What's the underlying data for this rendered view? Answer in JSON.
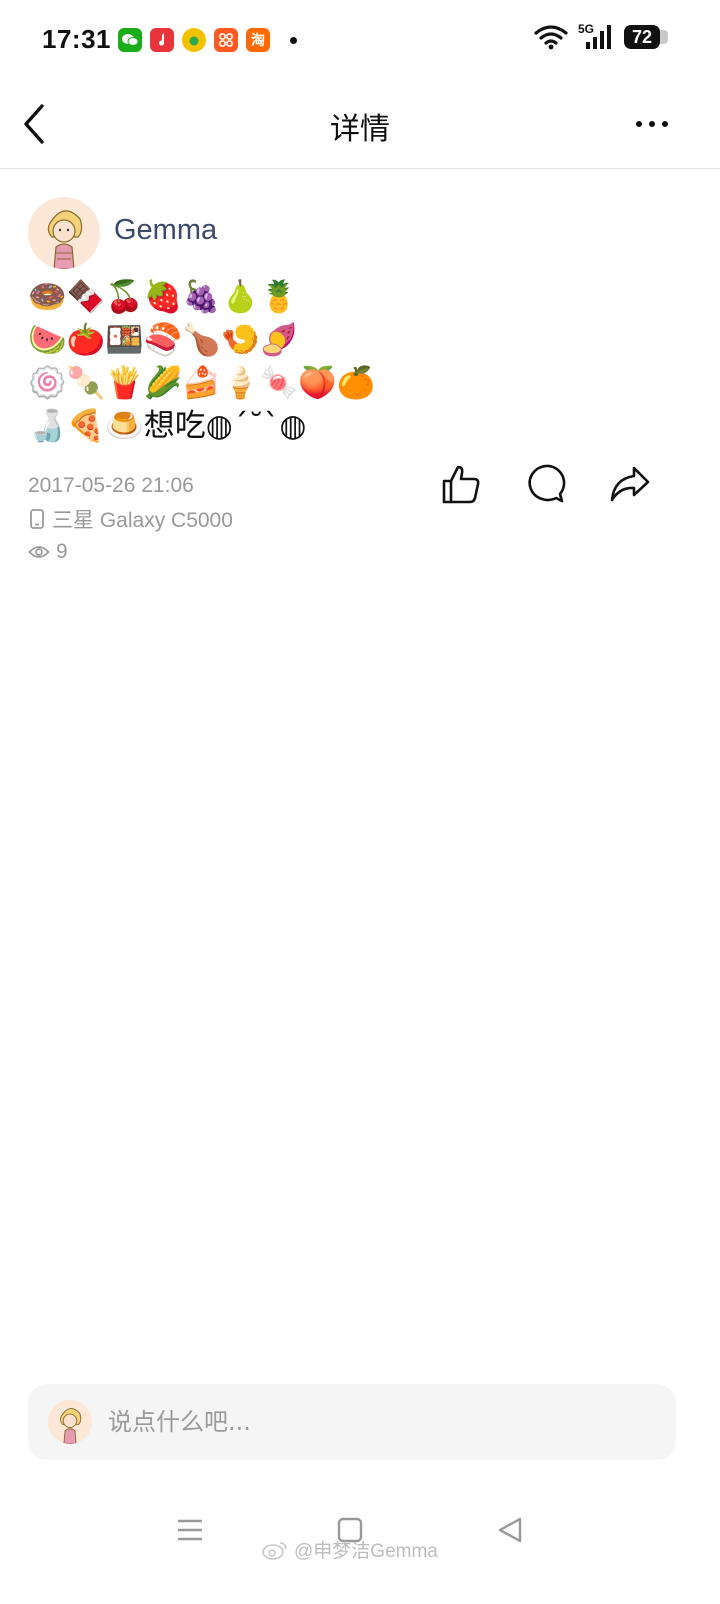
{
  "status_bar": {
    "time": "17:31",
    "network": "5G",
    "battery": "72",
    "app_icons": [
      {
        "name": "wechat-icon",
        "color": "#1aad19"
      },
      {
        "name": "music-icon",
        "color": "#e8343a"
      },
      {
        "name": "fruit-icon",
        "color": "#f2c200"
      },
      {
        "name": "grid-app-icon",
        "color": "#ff5a1f"
      },
      {
        "name": "taobao-icon",
        "color": "#ff6a00",
        "glyph": "淘"
      }
    ]
  },
  "nav": {
    "title": "详情"
  },
  "post": {
    "username": "Gemma",
    "content": "🍩🍫🍒🍓🍇🍐🍍\n🍉🍅🍱🍣🍗🍤🍠\n🍥🍡🍟🌽🍰🍦🍬🍑🍊\n🍶🍕🍮想吃◍´˘`◍",
    "timestamp": "2017-05-26 21:06",
    "device": "三星 Galaxy C5000",
    "views": "9"
  },
  "comment": {
    "placeholder": "说点什么吧..."
  },
  "watermark": "@申梦洁Gemma",
  "colors": {
    "username": "#3b4a6b",
    "meta": "#999999",
    "comment_bg": "#f5f5f5"
  }
}
